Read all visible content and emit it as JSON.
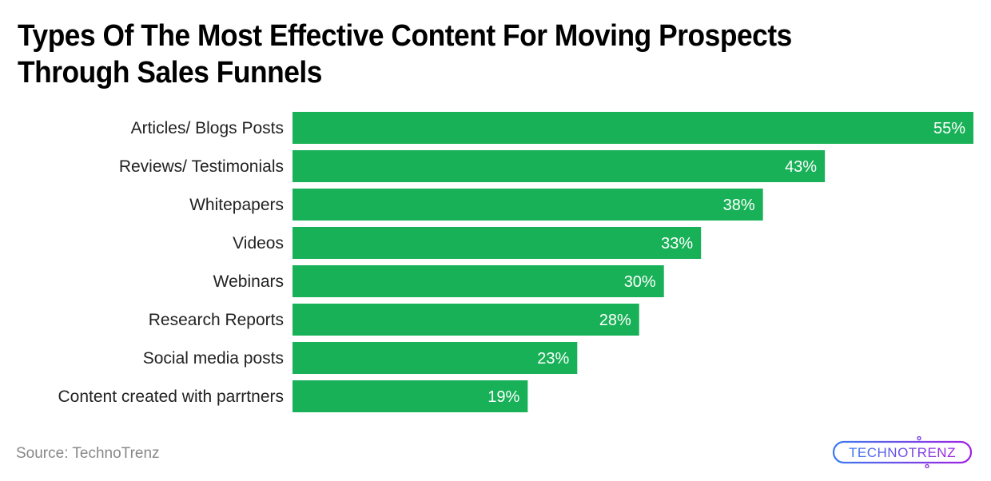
{
  "title": "Types Of The Most Effective Content For Moving Prospects Through Sales Funnels",
  "source": "Source: TechnoTrenz",
  "logo": {
    "text": "TECHNOTRENZ",
    "gradient_start": "#3b7bf0",
    "gradient_end": "#a020e0"
  },
  "colors": {
    "bar": "#18b157",
    "value_label": "#ffffff",
    "category_label": "#222222"
  },
  "chart_data": {
    "type": "bar",
    "orientation": "horizontal",
    "title": "Types Of The Most Effective Content For Moving Prospects Through Sales Funnels",
    "xlabel": "",
    "ylabel": "",
    "categories": [
      "Articles/ Blogs Posts",
      "Reviews/ Testimonials",
      "Whitepapers",
      "Videos",
      "Webinars",
      "Research Reports",
      "Social media posts",
      "Content created with parrtners"
    ],
    "values": [
      55,
      43,
      38,
      33,
      30,
      28,
      23,
      19
    ],
    "value_labels": [
      "55%",
      "43%",
      "38%",
      "33%",
      "30%",
      "28%",
      "23%",
      "19%"
    ],
    "unit": "%",
    "xlim": [
      0,
      55
    ],
    "grid": false,
    "legend": "none"
  }
}
